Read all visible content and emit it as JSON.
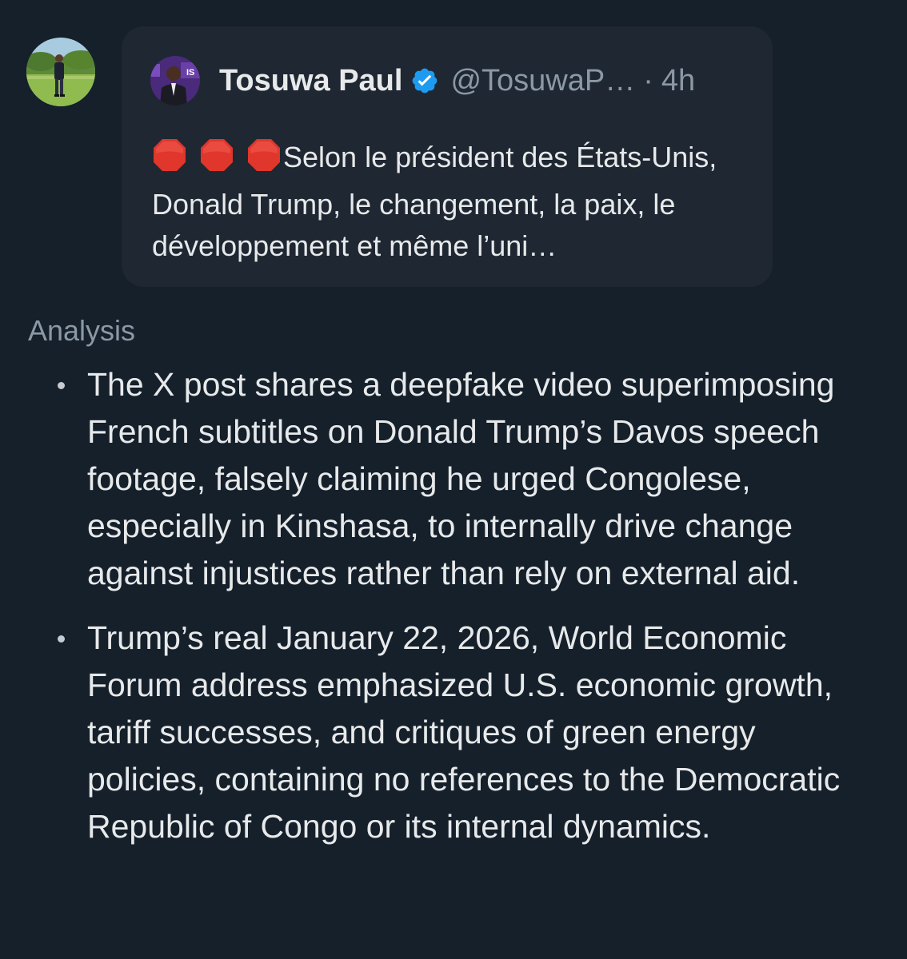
{
  "quoted_post": {
    "author_name": "Tosuwa Paul",
    "author_handle": "@TosuwaP…",
    "separator": "·",
    "time": "4h",
    "stop_emojis": [
      "🛑",
      "🛑",
      "🛑"
    ],
    "text": "Selon le président des États-Unis, Donald Trump, le changement, la paix, le développement et même l’uni…"
  },
  "analysis": {
    "heading": "Analysis",
    "bullets": [
      "The X post shares a deepfake video superimposing French subtitles on Donald Trump’s Davos speech footage, falsely claiming he urged Congolese, especially in Kinshasa, to internally drive change against injustices rather than rely on external aid.",
      "Trump’s real January 22, 2026, World Economic Forum address emphasized U.S. economic growth, tariff successes, and critiques of green energy policies, containing no references to the Democratic Republic of Congo or its internal dynamics."
    ]
  },
  "colors": {
    "background": "#15202b",
    "card": "#1e2732",
    "text_primary": "#e7e9ea",
    "text_secondary": "#8b98a5",
    "verified_badge": "#1d9bf0",
    "stop_sign": "#e0362b"
  }
}
